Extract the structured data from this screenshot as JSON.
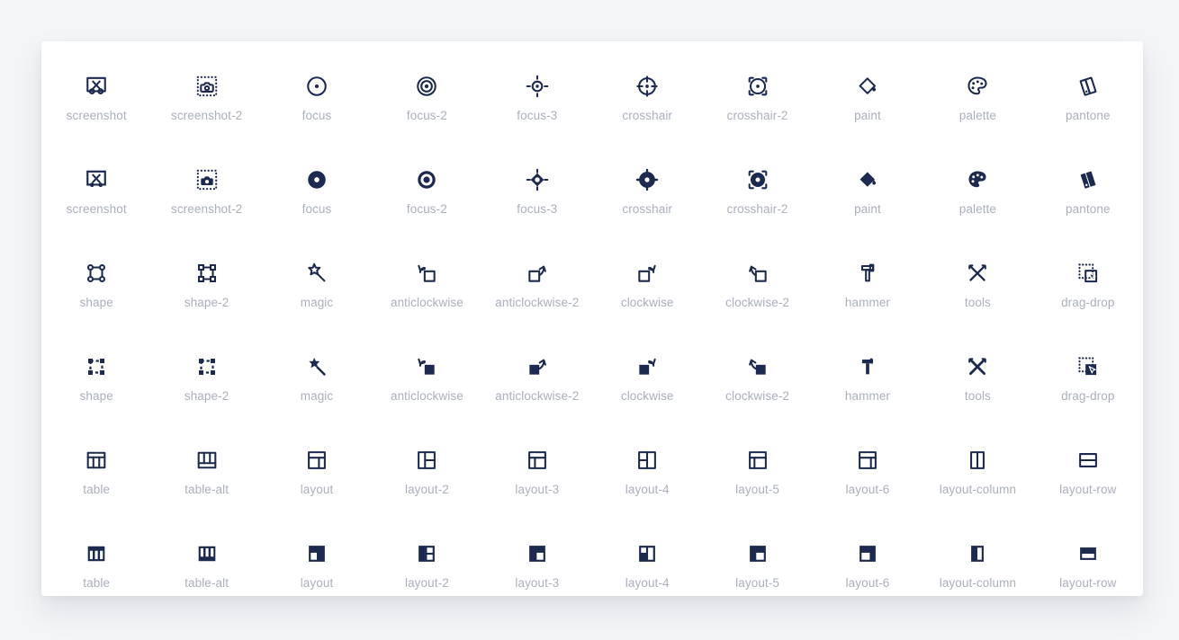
{
  "page": {
    "background_color": "#f4f5f7",
    "card_background": "#ffffff",
    "icon_color": "#1b2a4e",
    "label_color": "#aab0bd"
  },
  "grid": {
    "columns": 10,
    "rows": 6,
    "styles": [
      "outline",
      "filled",
      "outline",
      "filled",
      "outline",
      "filled"
    ]
  },
  "icons": [
    {
      "name": "screenshot",
      "label": "screenshot",
      "style": "outline",
      "glyph": "screenshot"
    },
    {
      "name": "screenshot-2",
      "label": "screenshot-2",
      "style": "outline",
      "glyph": "screenshot-2"
    },
    {
      "name": "focus",
      "label": "focus",
      "style": "outline",
      "glyph": "focus"
    },
    {
      "name": "focus-2",
      "label": "focus-2",
      "style": "outline",
      "glyph": "focus-2"
    },
    {
      "name": "focus-3",
      "label": "focus-3",
      "style": "outline",
      "glyph": "focus-3"
    },
    {
      "name": "crosshair",
      "label": "crosshair",
      "style": "outline",
      "glyph": "crosshair"
    },
    {
      "name": "crosshair-2",
      "label": "crosshair-2",
      "style": "outline",
      "glyph": "crosshair-2"
    },
    {
      "name": "paint",
      "label": "paint",
      "style": "outline",
      "glyph": "paint"
    },
    {
      "name": "palette",
      "label": "palette",
      "style": "outline",
      "glyph": "palette"
    },
    {
      "name": "pantone",
      "label": "pantone",
      "style": "outline",
      "glyph": "pantone"
    },
    {
      "name": "screenshot",
      "label": "screenshot",
      "style": "filled",
      "glyph": "screenshot"
    },
    {
      "name": "screenshot-2",
      "label": "screenshot-2",
      "style": "filled",
      "glyph": "screenshot-2"
    },
    {
      "name": "focus",
      "label": "focus",
      "style": "filled",
      "glyph": "focus"
    },
    {
      "name": "focus-2",
      "label": "focus-2",
      "style": "filled",
      "glyph": "focus-2"
    },
    {
      "name": "focus-3",
      "label": "focus-3",
      "style": "filled",
      "glyph": "focus-3"
    },
    {
      "name": "crosshair",
      "label": "crosshair",
      "style": "filled",
      "glyph": "crosshair"
    },
    {
      "name": "crosshair-2",
      "label": "crosshair-2",
      "style": "filled",
      "glyph": "crosshair-2"
    },
    {
      "name": "paint",
      "label": "paint",
      "style": "filled",
      "glyph": "paint"
    },
    {
      "name": "palette",
      "label": "palette",
      "style": "filled",
      "glyph": "palette"
    },
    {
      "name": "pantone",
      "label": "pantone",
      "style": "filled",
      "glyph": "pantone"
    },
    {
      "name": "shape",
      "label": "shape",
      "style": "outline",
      "glyph": "shape"
    },
    {
      "name": "shape-2",
      "label": "shape-2",
      "style": "outline",
      "glyph": "shape-2"
    },
    {
      "name": "magic",
      "label": "magic",
      "style": "outline",
      "glyph": "magic"
    },
    {
      "name": "anticlockwise",
      "label": "anticlockwise",
      "style": "outline",
      "glyph": "anticlockwise"
    },
    {
      "name": "anticlockwise-2",
      "label": "anticlockwise-2",
      "style": "outline",
      "glyph": "anticlockwise-2"
    },
    {
      "name": "clockwise",
      "label": "clockwise",
      "style": "outline",
      "glyph": "clockwise"
    },
    {
      "name": "clockwise-2",
      "label": "clockwise-2",
      "style": "outline",
      "glyph": "clockwise-2"
    },
    {
      "name": "hammer",
      "label": "hammer",
      "style": "outline",
      "glyph": "hammer"
    },
    {
      "name": "tools",
      "label": "tools",
      "style": "outline",
      "glyph": "tools"
    },
    {
      "name": "drag-drop",
      "label": "drag-drop",
      "style": "outline",
      "glyph": "drag-drop"
    },
    {
      "name": "shape",
      "label": "shape",
      "style": "filled",
      "glyph": "shape"
    },
    {
      "name": "shape-2",
      "label": "shape-2",
      "style": "filled",
      "glyph": "shape-2"
    },
    {
      "name": "magic",
      "label": "magic",
      "style": "filled",
      "glyph": "magic"
    },
    {
      "name": "anticlockwise",
      "label": "anticlockwise",
      "style": "filled",
      "glyph": "anticlockwise"
    },
    {
      "name": "anticlockwise-2",
      "label": "anticlockwise-2",
      "style": "filled",
      "glyph": "anticlockwise-2"
    },
    {
      "name": "clockwise",
      "label": "clockwise",
      "style": "filled",
      "glyph": "clockwise"
    },
    {
      "name": "clockwise-2",
      "label": "clockwise-2",
      "style": "filled",
      "glyph": "clockwise-2"
    },
    {
      "name": "hammer",
      "label": "hammer",
      "style": "filled",
      "glyph": "hammer"
    },
    {
      "name": "tools",
      "label": "tools",
      "style": "filled",
      "glyph": "tools"
    },
    {
      "name": "drag-drop",
      "label": "drag-drop",
      "style": "filled",
      "glyph": "drag-drop"
    },
    {
      "name": "table",
      "label": "table",
      "style": "outline",
      "glyph": "table"
    },
    {
      "name": "table-alt",
      "label": "table-alt",
      "style": "outline",
      "glyph": "table-alt"
    },
    {
      "name": "layout",
      "label": "layout",
      "style": "outline",
      "glyph": "layout"
    },
    {
      "name": "layout-2",
      "label": "layout-2",
      "style": "outline",
      "glyph": "layout-2"
    },
    {
      "name": "layout-3",
      "label": "layout-3",
      "style": "outline",
      "glyph": "layout-3"
    },
    {
      "name": "layout-4",
      "label": "layout-4",
      "style": "outline",
      "glyph": "layout-4"
    },
    {
      "name": "layout-5",
      "label": "layout-5",
      "style": "outline",
      "glyph": "layout-5"
    },
    {
      "name": "layout-6",
      "label": "layout-6",
      "style": "outline",
      "glyph": "layout-6"
    },
    {
      "name": "layout-column",
      "label": "layout-column",
      "style": "outline",
      "glyph": "layout-column"
    },
    {
      "name": "layout-row",
      "label": "layout-row",
      "style": "outline",
      "glyph": "layout-row"
    },
    {
      "name": "table",
      "label": "table",
      "style": "filled",
      "glyph": "table"
    },
    {
      "name": "table-alt",
      "label": "table-alt",
      "style": "filled",
      "glyph": "table-alt"
    },
    {
      "name": "layout",
      "label": "layout",
      "style": "filled",
      "glyph": "layout"
    },
    {
      "name": "layout-2",
      "label": "layout-2",
      "style": "filled",
      "glyph": "layout-2"
    },
    {
      "name": "layout-3",
      "label": "layout-3",
      "style": "filled",
      "glyph": "layout-3"
    },
    {
      "name": "layout-4",
      "label": "layout-4",
      "style": "filled",
      "glyph": "layout-4"
    },
    {
      "name": "layout-5",
      "label": "layout-5",
      "style": "filled",
      "glyph": "layout-5"
    },
    {
      "name": "layout-6",
      "label": "layout-6",
      "style": "filled",
      "glyph": "layout-6"
    },
    {
      "name": "layout-column",
      "label": "layout-column",
      "style": "filled",
      "glyph": "layout-column"
    },
    {
      "name": "layout-row",
      "label": "layout-row",
      "style": "filled",
      "glyph": "layout-row"
    }
  ]
}
